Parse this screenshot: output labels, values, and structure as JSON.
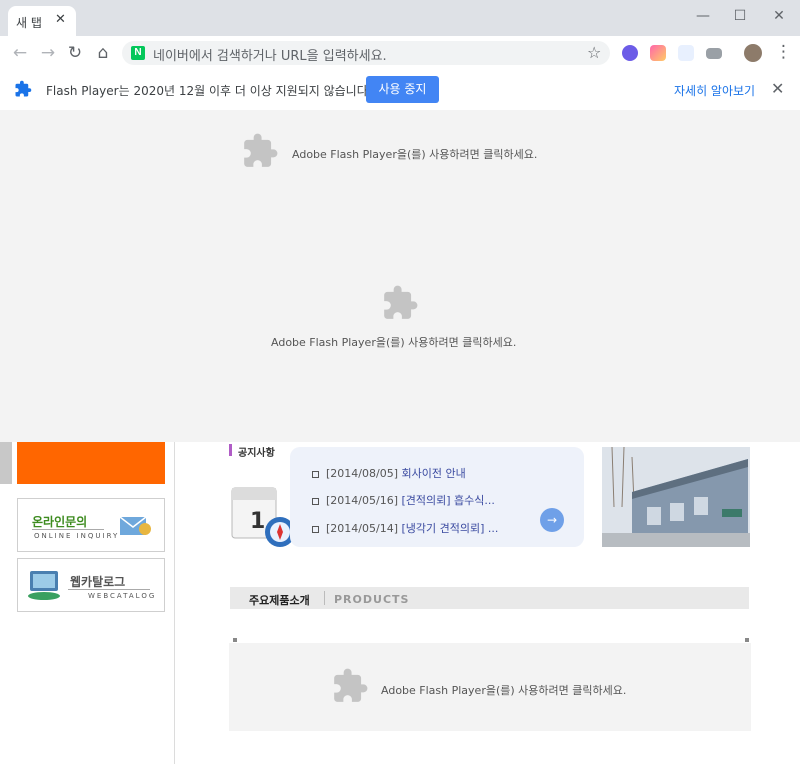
{
  "browser": {
    "tab_title": "새 탭",
    "tab_close": "✕",
    "omnibox_placeholder": "네이버에서 검색하거나 URL을 입력하세요.",
    "naver_logo_letter": "N",
    "window_controls": {
      "minimize": "—",
      "maximize": "☐",
      "close": "✕"
    },
    "nav_icons": {
      "back": "←",
      "forward": "→",
      "reload": "↻",
      "home": "⌂"
    },
    "star": "☆",
    "menu": "⋮"
  },
  "infobar": {
    "message": "Flash Player는 2020년 12월 이후 더 이상 지원되지 않습니다.",
    "stop_button": "사용 중지",
    "learn_more": "자세히 알아보기",
    "close": "✕"
  },
  "flash": {
    "message": "Adobe Flash Player을(를) 사용하려면 클릭하세요."
  },
  "page": {
    "quick_links": [
      {
        "title": "온라인문의",
        "subtitle": "ONLINE INQUIRY"
      },
      {
        "title": "웹카탈로그",
        "subtitle": "WEBCATALOG"
      }
    ],
    "notice": {
      "title": "공지사항",
      "items": [
        {
          "date": "[2014/08/05]",
          "text": "회사이전 안내"
        },
        {
          "date": "[2014/05/16]",
          "text": "[견적의뢰] 흡수식..."
        },
        {
          "date": "[2014/05/14]",
          "text": "[냉각기 견적의뢰] ..."
        }
      ],
      "calendar_digit": "1"
    },
    "products": {
      "ko": "주요제품소개",
      "en": "PRODUCTS"
    }
  },
  "colors": {
    "accent_blue": "#4285f4",
    "orange": "#ff6600",
    "notice_purple": "#b05cc6"
  }
}
